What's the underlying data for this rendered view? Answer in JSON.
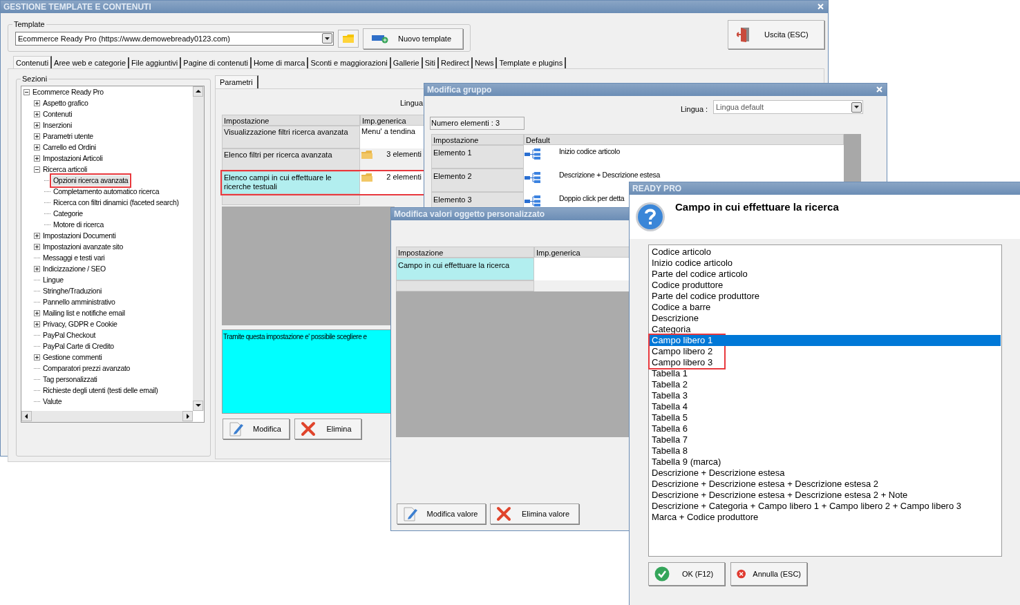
{
  "main_window": {
    "title": "GESTIONE TEMPLATE E CONTENUTI",
    "template_group": {
      "label": "Template",
      "combo_value": "Ecommerce Ready Pro (https://www.demowebready0123.com)",
      "new_button": "Nuovo template"
    },
    "exit_button": "Uscita (ESC)",
    "tabs": [
      {
        "label": "Contenuti",
        "selected": true
      },
      {
        "label": "Aree web e categorie",
        "selected": false
      },
      {
        "label": "File aggiuntivi",
        "selected": false
      },
      {
        "label": "Pagine di contenuti",
        "selected": false
      },
      {
        "label": "Home di marca",
        "selected": false
      },
      {
        "label": "Sconti e maggiorazioni",
        "selected": false
      },
      {
        "label": "Gallerie",
        "selected": false
      },
      {
        "label": "Siti",
        "selected": false
      },
      {
        "label": "Redirect",
        "selected": false
      },
      {
        "label": "News",
        "selected": false
      },
      {
        "label": "Template e plugins",
        "selected": false
      }
    ],
    "sections": {
      "label": "Sezioni",
      "tree": [
        {
          "label": "Ecommerce Ready Pro",
          "kind": "group",
          "expanded": true,
          "highlighted": false,
          "children": [
            {
              "label": "Aspetto grafico",
              "kind": "group",
              "expanded": false,
              "highlighted": false
            },
            {
              "label": "Contenuti",
              "kind": "group",
              "expanded": false,
              "highlighted": false
            },
            {
              "label": "Inserzioni",
              "kind": "group",
              "expanded": false,
              "highlighted": false
            },
            {
              "label": "Parametri utente",
              "kind": "group",
              "expanded": false,
              "highlighted": false
            },
            {
              "label": "Carrello ed Ordini",
              "kind": "group",
              "expanded": false,
              "highlighted": false
            },
            {
              "label": "Impostazioni Articoli",
              "kind": "group",
              "expanded": false,
              "highlighted": false
            },
            {
              "label": "Ricerca articoli",
              "kind": "group",
              "expanded": true,
              "highlighted": false,
              "children": [
                {
                  "label": "Opzioni ricerca avanzata",
                  "kind": "leaf",
                  "highlighted": true
                },
                {
                  "label": "Completamento automatico ricerca",
                  "kind": "leaf",
                  "highlighted": false
                },
                {
                  "label": "Ricerca con filtri dinamici (faceted search)",
                  "kind": "leaf",
                  "highlighted": false
                },
                {
                  "label": "Categorie",
                  "kind": "leaf",
                  "highlighted": false
                },
                {
                  "label": "Motore di ricerca",
                  "kind": "leaf",
                  "highlighted": false
                }
              ]
            },
            {
              "label": "Impostazioni Documenti",
              "kind": "group",
              "expanded": false,
              "highlighted": false
            },
            {
              "label": "Impostazioni avanzate sito",
              "kind": "group",
              "expanded": false,
              "highlighted": false
            },
            {
              "label": "Messaggi e testi vari",
              "kind": "leaf",
              "highlighted": false
            },
            {
              "label": "Indicizzazione / SEO",
              "kind": "group",
              "expanded": false,
              "highlighted": false
            },
            {
              "label": "Lingue",
              "kind": "leaf",
              "highlighted": false
            },
            {
              "label": "Stringhe/Traduzioni",
              "kind": "leaf",
              "highlighted": false
            },
            {
              "label": "Pannello amministrativo",
              "kind": "leaf",
              "highlighted": false
            },
            {
              "label": "Mailing list e notifiche email",
              "kind": "group",
              "expanded": false,
              "highlighted": false
            },
            {
              "label": "Privacy, GDPR e Cookie",
              "kind": "group",
              "expanded": false,
              "highlighted": false
            },
            {
              "label": "PayPal Checkout",
              "kind": "leaf",
              "highlighted": false
            },
            {
              "label": "PayPal Carte di Credito",
              "kind": "leaf",
              "highlighted": false
            },
            {
              "label": "Gestione commenti",
              "kind": "group",
              "expanded": false,
              "highlighted": false
            },
            {
              "label": "Comparatori prezzi avanzato",
              "kind": "leaf",
              "highlighted": false
            },
            {
              "label": "Tag personalizzati",
              "kind": "leaf",
              "highlighted": false
            },
            {
              "label": "Richieste degli utenti (testi delle email)",
              "kind": "leaf",
              "highlighted": false
            },
            {
              "label": "Valute",
              "kind": "leaf",
              "highlighted": false
            }
          ]
        }
      ]
    },
    "subtabs": [
      {
        "label": "Parametri",
        "selected": true
      }
    ],
    "language_label": "Lingua",
    "table": {
      "columns": [
        "Impostazione",
        "Imp.generica"
      ],
      "rows": [
        {
          "setting": "Visualizzazione filtri ricerca avanzata",
          "value": "Menu' a tendina",
          "kind": "text",
          "selected": false,
          "highlighted": false
        },
        {
          "setting": "Elenco filtri per ricerca avanzata",
          "value": "3 elementi",
          "kind": "folder",
          "selected": false,
          "highlighted": false
        },
        {
          "setting": "Elenco campi in cui effettuare le ricerche testuali",
          "value": "2 elementi",
          "kind": "folder",
          "selected": true,
          "highlighted": true
        }
      ]
    },
    "description": "Tramite questa impostazione e' possibile scegliere e",
    "buttons": [
      {
        "label": "Modifica",
        "kind": "edit"
      },
      {
        "label": "Elimina",
        "kind": "delete"
      }
    ]
  },
  "group_dialog": {
    "title": "Modifica gruppo",
    "language_label": "Lingua :",
    "language_value": "Lingua default",
    "count": "Numero elementi : 3",
    "table": {
      "columns": [
        "Impostazione",
        "Default"
      ],
      "rows": [
        {
          "setting": "Elemento 1",
          "value": "Inizio codice articolo"
        },
        {
          "setting": "Elemento 2",
          "value": "Descrizione + Descrizione estesa"
        },
        {
          "setting": "Elemento 3",
          "value": "Doppio click per detta"
        }
      ]
    }
  },
  "values_dialog": {
    "title": "Modifica valori oggetto personalizzato",
    "table": {
      "columns": [
        "Impostazione",
        "Imp.generica"
      ],
      "rows": [
        {
          "setting": "Campo in cui effettuare la ricerca",
          "selected": true
        }
      ]
    },
    "buttons": [
      {
        "label": "Modifica valore",
        "kind": "edit"
      },
      {
        "label": "Elimina valore",
        "kind": "delete"
      }
    ]
  },
  "ready_dialog": {
    "title": "READY PRO",
    "heading": "Campo in cui effettuare la ricerca",
    "options": [
      {
        "label": "Codice articolo",
        "selected": false,
        "highlighted": false
      },
      {
        "label": "Inizio codice articolo",
        "selected": false,
        "highlighted": false
      },
      {
        "label": "Parte del codice articolo",
        "selected": false,
        "highlighted": false
      },
      {
        "label": "Codice produttore",
        "selected": false,
        "highlighted": false
      },
      {
        "label": "Parte del codice produttore",
        "selected": false,
        "highlighted": false
      },
      {
        "label": "Codice a barre",
        "selected": false,
        "highlighted": false
      },
      {
        "label": "Descrizione",
        "selected": false,
        "highlighted": false
      },
      {
        "label": "Categoria",
        "selected": false,
        "highlighted": false
      },
      {
        "label": "Campo libero 1",
        "selected": true,
        "highlighted": true
      },
      {
        "label": "Campo libero 2",
        "selected": false,
        "highlighted": true
      },
      {
        "label": "Campo libero 3",
        "selected": false,
        "highlighted": true
      },
      {
        "label": "Tabella 1",
        "selected": false,
        "highlighted": false
      },
      {
        "label": "Tabella 2",
        "selected": false,
        "highlighted": false
      },
      {
        "label": "Tabella 3",
        "selected": false,
        "highlighted": false
      },
      {
        "label": "Tabella 4",
        "selected": false,
        "highlighted": false
      },
      {
        "label": "Tabella 5",
        "selected": false,
        "highlighted": false
      },
      {
        "label": "Tabella 6",
        "selected": false,
        "highlighted": false
      },
      {
        "label": "Tabella 7",
        "selected": false,
        "highlighted": false
      },
      {
        "label": "Tabella 8",
        "selected": false,
        "highlighted": false
      },
      {
        "label": "Tabella 9 (marca)",
        "selected": false,
        "highlighted": false
      },
      {
        "label": "Descrizione + Descrizione estesa",
        "selected": false,
        "highlighted": false
      },
      {
        "label": "Descrizione + Descrizione estesa + Descrizione estesa 2",
        "selected": false,
        "highlighted": false
      },
      {
        "label": "Descrizione + Descrizione estesa + Descrizione estesa 2 + Note",
        "selected": false,
        "highlighted": false
      },
      {
        "label": "Descrizione + Categoria + Campo libero 1 + Campo libero 2 + Campo libero 3",
        "selected": false,
        "highlighted": false
      },
      {
        "label": "Marca + Codice produttore",
        "selected": false,
        "highlighted": false
      }
    ],
    "buttons": [
      {
        "label": "OK (F12)",
        "kind": "ok"
      },
      {
        "label": "Annulla (ESC)",
        "kind": "cancel"
      }
    ]
  }
}
